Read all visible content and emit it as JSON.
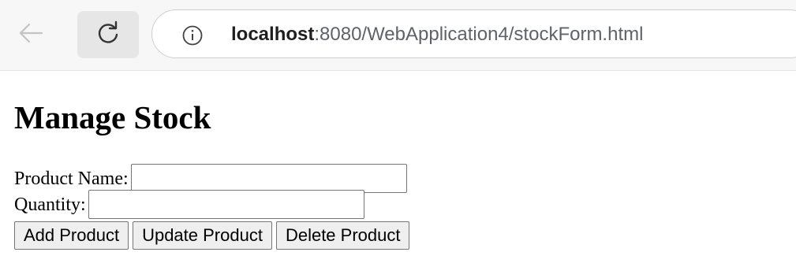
{
  "browser": {
    "url_host": "localhost",
    "url_rest": ":8080/WebApplication4/stockForm.html"
  },
  "page": {
    "title": "Manage Stock"
  },
  "form": {
    "product_name_label": "Product Name:",
    "product_name_value": "",
    "quantity_label": "Quantity:",
    "quantity_value": ""
  },
  "buttons": {
    "add_label": "Add Product",
    "update_label": "Update Product",
    "delete_label": "Delete Product"
  },
  "icons": [
    "back-arrow-icon",
    "reload-icon",
    "info-icon"
  ]
}
